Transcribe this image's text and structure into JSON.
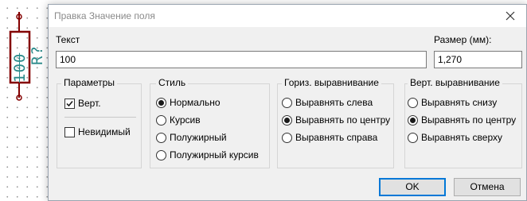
{
  "schematic": {
    "reference": "R?",
    "value": "100"
  },
  "dialog": {
    "title": "Правка Значение поля",
    "text_label": "Текст",
    "text_value": "100",
    "size_label": "Размер (мм):",
    "size_value": "1,270",
    "params": {
      "title": "Параметры",
      "vertical": {
        "label": "Верт.",
        "checked": true
      },
      "invisible": {
        "label": "Невидимый",
        "checked": false
      }
    },
    "style": {
      "title": "Стиль",
      "options": [
        "Нормально",
        "Курсив",
        "Полужирный",
        "Полужирный курсив"
      ],
      "selected": "Нормально"
    },
    "halign": {
      "title": "Гориз. выравнивание",
      "options": [
        "Выравнять слева",
        "Выравнять по центру",
        "Выравнять справа"
      ],
      "selected": "Выравнять по центру"
    },
    "valign": {
      "title": "Верт. выравнивание",
      "options": [
        "Выравнять снизу",
        "Выравнять по центру",
        "Выравнять сверху"
      ],
      "selected": "Выравнять по центру"
    },
    "ok_label": "OK",
    "cancel_label": "Отмена"
  },
  "colors": {
    "component": "#840000",
    "text": "#2a8a8a",
    "accent": "#0078d7"
  },
  "icons": {
    "close": "close-icon",
    "checkmark": "checkmark-icon"
  }
}
